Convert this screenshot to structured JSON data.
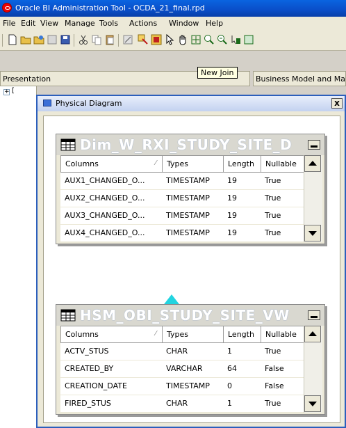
{
  "app": {
    "title": "Oracle BI Administration Tool - OCDA_21_final.rpd"
  },
  "menu": [
    "File",
    "Edit",
    "View",
    "Manage",
    "Tools",
    "Actions",
    "Window",
    "Help"
  ],
  "tooltip": "New Join",
  "panes": {
    "presentation": "Presentation",
    "business_model": "Business Model and Ma"
  },
  "tree": {
    "expander": "+",
    "root": "["
  },
  "diagram": {
    "title": "Physical Diagram",
    "close": "x"
  },
  "columns_header": [
    "Columns",
    "Types",
    "Length",
    "Nullable"
  ],
  "tables": [
    {
      "name": "Dim_W_RXI_STUDY_SITE_D",
      "rows": [
        [
          "AUX1_CHANGED_O...",
          "TIMESTAMP",
          "19",
          "True"
        ],
        [
          "AUX2_CHANGED_O...",
          "TIMESTAMP",
          "19",
          "True"
        ],
        [
          "AUX3_CHANGED_O...",
          "TIMESTAMP",
          "19",
          "True"
        ],
        [
          "AUX4_CHANGED_O...",
          "TIMESTAMP",
          "19",
          "True"
        ]
      ]
    },
    {
      "name": "HSM_OBI_STUDY_SITE_VW",
      "rows": [
        [
          "ACTV_STUS",
          "CHAR",
          "1",
          "True"
        ],
        [
          "CREATED_BY",
          "VARCHAR",
          "64",
          "False"
        ],
        [
          "CREATION_DATE",
          "TIMESTAMP",
          "0",
          "False"
        ],
        [
          "FIRED_STUS",
          "CHAR",
          "1",
          "True"
        ]
      ]
    }
  ],
  "colors": {
    "title_blue": "#0a4ec8",
    "join_arrow": "#22d4e0",
    "table_name": "#ffffff"
  }
}
